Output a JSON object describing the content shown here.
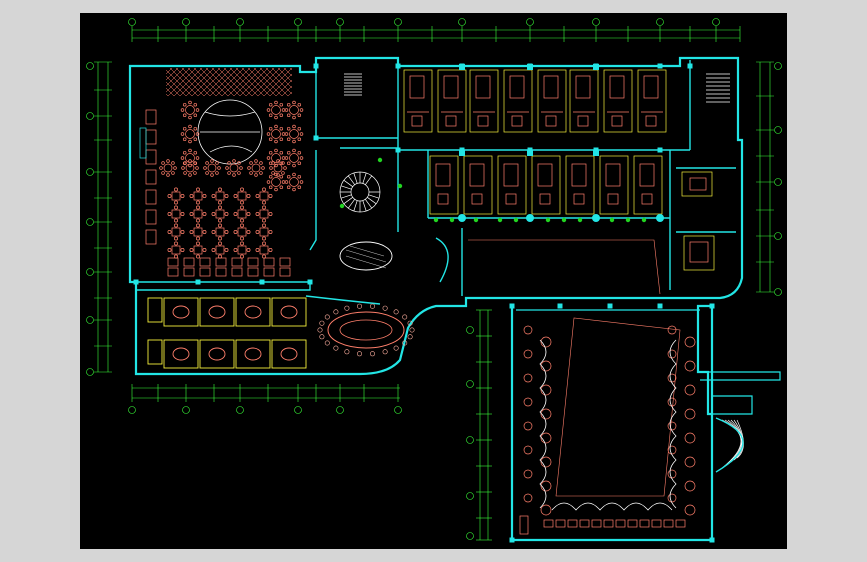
{
  "drawing": {
    "kind": "cad-floor-plan",
    "background": "#000000",
    "canvas_bg": "#d6d6d6",
    "colors": {
      "wall": "#22e5e5",
      "furniture": "#ff7f6b",
      "furniture_alt": "#ffb0a0",
      "dimension": "#39ff39",
      "yellow": "#f5f03c",
      "white": "#ffffff",
      "label": "#ff3b3b",
      "green": "#21d421"
    }
  },
  "labels": {
    "l1": "",
    "l2": "",
    "l3": "",
    "l4": "",
    "l5": "",
    "l6": "",
    "l7": "",
    "l8": "",
    "l9": ""
  }
}
